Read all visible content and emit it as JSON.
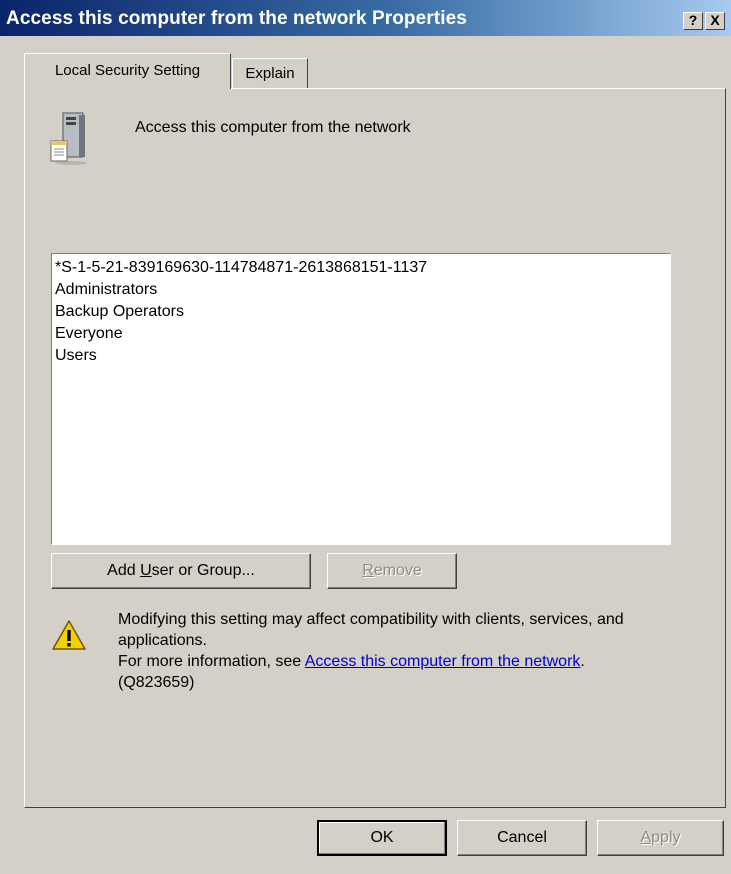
{
  "window": {
    "title": "Access this computer from the network Properties",
    "help_label": "?",
    "close_label": "X"
  },
  "tabs": [
    {
      "label": "Local Security Setting",
      "active": true
    },
    {
      "label": "Explain",
      "active": false
    }
  ],
  "policy": {
    "icon": "server-icon",
    "name": "Access this computer from the network"
  },
  "members": [
    "*S-1-5-21-839169630-114784871-2613868151-1137",
    "Administrators",
    "Backup Operators",
    "Everyone",
    "Users"
  ],
  "buttons": {
    "add": {
      "pre": "Add ",
      "accel": "U",
      "post": "ser or Group..."
    },
    "remove": {
      "pre": "",
      "accel": "R",
      "post": "emove",
      "enabled": false
    },
    "ok": "OK",
    "cancel": "Cancel",
    "apply": {
      "pre": "",
      "accel": "A",
      "post": "pply",
      "enabled": false
    }
  },
  "warning": {
    "icon": "warning-icon",
    "line1": "Modifying this setting may affect compatibility with clients, services, and applications.",
    "more_prefix": "For more information, see ",
    "link_text": "Access this computer from the network",
    "more_suffix": ".",
    "kb": "(Q823659)"
  },
  "colors": {
    "title_gradient_start": "#0a246a",
    "title_gradient_end": "#a6caf0",
    "face": "#d4d0c8",
    "link": "#0000cc"
  }
}
